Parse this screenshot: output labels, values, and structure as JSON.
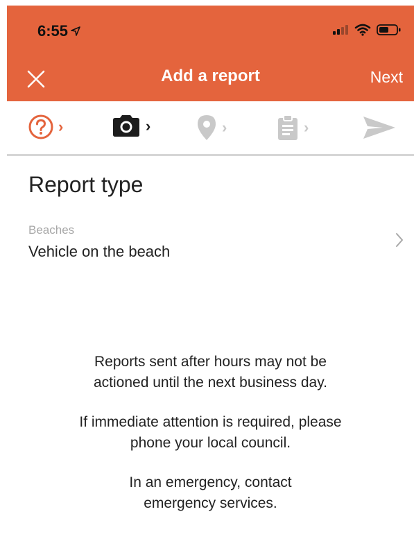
{
  "colors": {
    "brand": "#e4643d",
    "active_step": "#e4643d",
    "inactive_step": "#c9c9c9"
  },
  "status_bar": {
    "time": "6:55",
    "icons": [
      "location-arrow-icon",
      "signal-icon",
      "wifi-icon",
      "battery-icon"
    ]
  },
  "nav": {
    "title": "Add a report",
    "next_label": "Next",
    "close_icon": "close-icon"
  },
  "steps": [
    {
      "icon": "question-circle-icon",
      "state": "active"
    },
    {
      "icon": "camera-icon",
      "state": "done"
    },
    {
      "icon": "location-pin-icon",
      "state": "pending"
    },
    {
      "icon": "clipboard-icon",
      "state": "pending"
    },
    {
      "icon": "send-icon",
      "state": "pending"
    }
  ],
  "report": {
    "section_title": "Report type",
    "category": "Beaches",
    "type": "Vehicle on the beach"
  },
  "notices": [
    {
      "line1": "Reports sent after hours may not be",
      "line2": "actioned until the next business day."
    },
    {
      "line1": "If immediate attention is required, please",
      "line2": "phone your local council."
    },
    {
      "line1": "In an emergency, contact",
      "line2": "emergency services."
    }
  ]
}
